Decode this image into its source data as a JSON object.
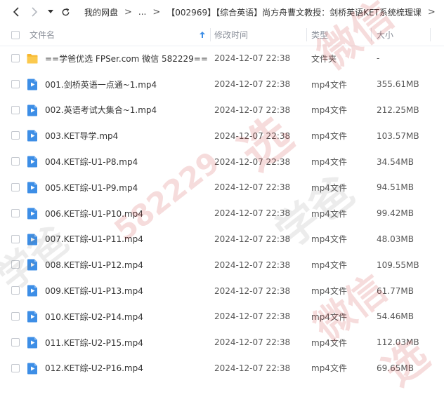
{
  "breadcrumb": {
    "root": "我的网盘",
    "ellipsis": "...",
    "current": "【002969】【综合英语】尚方舟曹文教授：剑桥英语KET系统梳理课"
  },
  "columns": {
    "name": "文件名",
    "modified": "修改时间",
    "type": "类型",
    "size": "大小"
  },
  "files": [
    {
      "name": "==学爸优选 FPSer.com 微信 582229==",
      "modified": "2024-12-07 22:38",
      "type": "文件夹",
      "size": "-",
      "icon": "folder-icon"
    },
    {
      "name": "001.剑桥英语一点通~1.mp4",
      "modified": "2024-12-07 22:38",
      "type": "mp4文件",
      "size": "355.61MB",
      "icon": "video-file-icon"
    },
    {
      "name": "002.英语考试大集合~1.mp4",
      "modified": "2024-12-07 22:38",
      "type": "mp4文件",
      "size": "212.25MB",
      "icon": "video-file-icon"
    },
    {
      "name": "003.KET导学.mp4",
      "modified": "2024-12-07 22:38",
      "type": "mp4文件",
      "size": "103.57MB",
      "icon": "video-file-icon"
    },
    {
      "name": "004.KET综-U1-P8.mp4",
      "modified": "2024-12-07 22:38",
      "type": "mp4文件",
      "size": "34.54MB",
      "icon": "video-file-icon"
    },
    {
      "name": "005.KET综-U1-P9.mp4",
      "modified": "2024-12-07 22:38",
      "type": "mp4文件",
      "size": "94.51MB",
      "icon": "video-file-icon"
    },
    {
      "name": "006.KET综-U1-P10.mp4",
      "modified": "2024-12-07 22:38",
      "type": "mp4文件",
      "size": "99.42MB",
      "icon": "video-file-icon"
    },
    {
      "name": "007.KET综-U1-P11.mp4",
      "modified": "2024-12-07 22:38",
      "type": "mp4文件",
      "size": "48.03MB",
      "icon": "video-file-icon"
    },
    {
      "name": "008.KET综-U1-P12.mp4",
      "modified": "2024-12-07 22:38",
      "type": "mp4文件",
      "size": "109.55MB",
      "icon": "video-file-icon"
    },
    {
      "name": "009.KET综-U1-P13.mp4",
      "modified": "2024-12-07 22:38",
      "type": "mp4文件",
      "size": "61.77MB",
      "icon": "video-file-icon"
    },
    {
      "name": "010.KET综-U2-P14.mp4",
      "modified": "2024-12-07 22:38",
      "type": "mp4文件",
      "size": "54.46MB",
      "icon": "video-file-icon"
    },
    {
      "name": "011.KET综-U2-P15.mp4",
      "modified": "2024-12-07 22:38",
      "type": "mp4文件",
      "size": "112.03MB",
      "icon": "video-file-icon"
    },
    {
      "name": "012.KET综-U2-P16.mp4",
      "modified": "2024-12-07 22:38",
      "type": "mp4文件",
      "size": "69.65MB",
      "icon": "video-file-icon"
    }
  ],
  "watermark": {
    "brand": "学爸",
    "wechat": "微信",
    "pick": "选",
    "number": "582229"
  },
  "colors": {
    "video_icon": "#3d8ee6",
    "folder_icon": "#f7b72f",
    "header_text": "#8a8f99",
    "sort_arrow": "#3d8ee6"
  }
}
